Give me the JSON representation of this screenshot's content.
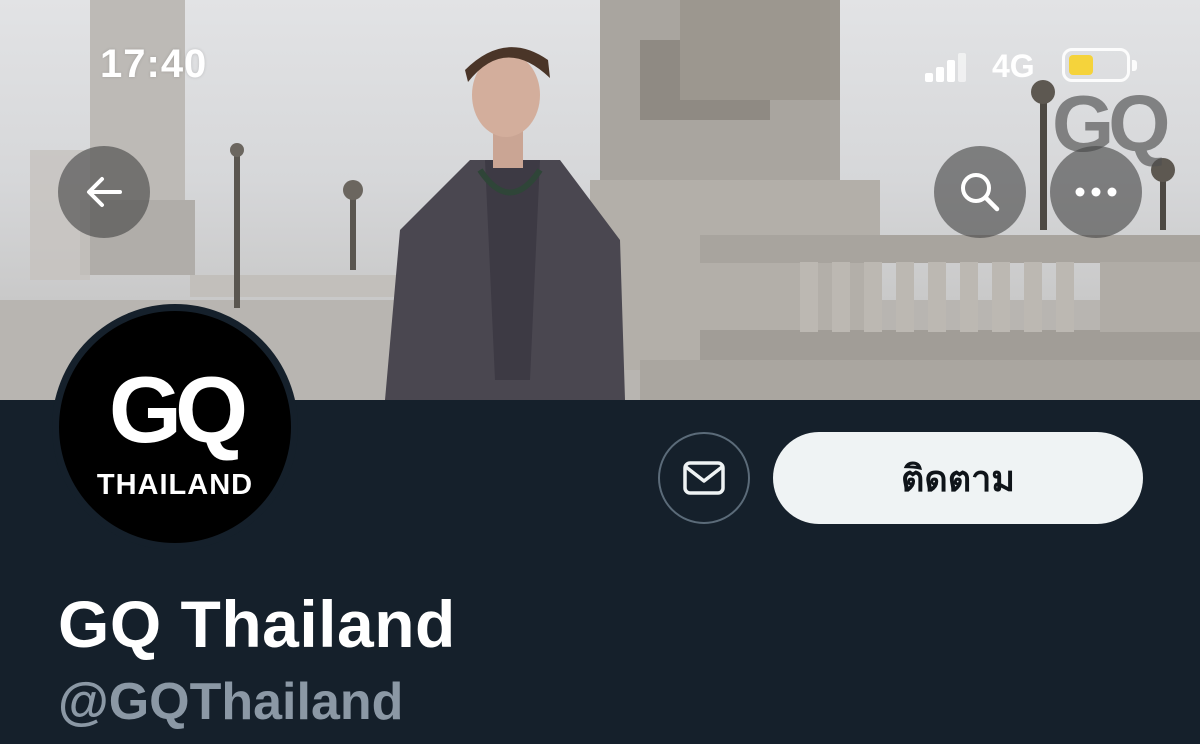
{
  "status_bar": {
    "time": "17:40",
    "network": "4G",
    "battery_color": "#f5d33b"
  },
  "banner": {
    "watermark": "GQ"
  },
  "nav": {
    "back_icon": "arrow-left-icon",
    "search_icon": "search-icon",
    "more_icon": "more-horizontal-icon"
  },
  "profile": {
    "avatar_logo_main": "GQ",
    "avatar_logo_sub": "THAILAND",
    "display_name": "GQ Thailand",
    "handle": "@GQThailand"
  },
  "actions": {
    "message_icon": "envelope-icon",
    "follow_label": "ติดตาม"
  },
  "colors": {
    "background": "#15202b",
    "follow_button_bg": "#eff3f4",
    "handle_text": "#8b98a5"
  }
}
